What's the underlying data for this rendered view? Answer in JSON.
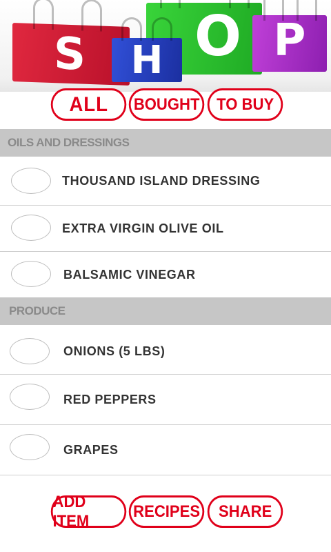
{
  "banner": {
    "letters": [
      "S",
      "H",
      "O",
      "P"
    ],
    "colors": {
      "red": "#d81f36",
      "blue": "#2540c0",
      "green": "#2ec22f",
      "purple": "#a530c8"
    }
  },
  "filters": {
    "all": "ALL",
    "bought": "BOUGHT",
    "to_buy": "TO BUY"
  },
  "sections": [
    {
      "title": "OILS AND DRESSINGS",
      "items": [
        {
          "label": "THOUSAND ISLAND DRESSING",
          "checked": false
        },
        {
          "label": "EXTRA VIRGIN OLIVE OIL",
          "checked": false
        },
        {
          "label": "BALSAMIC VINEGAR",
          "checked": false
        }
      ]
    },
    {
      "title": "PRODUCE",
      "items": [
        {
          "label": "ONIONS (5 LBS)",
          "checked": false
        },
        {
          "label": "RED PEPPERS",
          "checked": false
        },
        {
          "label": "GRAPES",
          "checked": false
        }
      ]
    }
  ],
  "actions": {
    "add_item": "ADD ITEM",
    "recipes": "RECIPES",
    "share": "SHARE"
  },
  "accent_color": "#e0001a"
}
